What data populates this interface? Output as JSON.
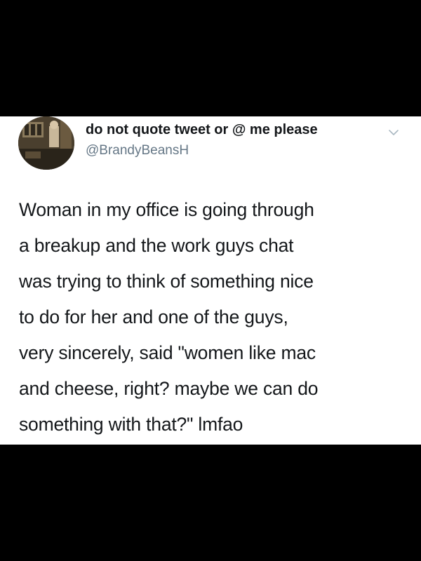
{
  "tweet": {
    "display_name": "do not quote tweet or @ me please",
    "handle": "@BrandyBeansH",
    "avatar_icon": "profile-photo-avatar",
    "menu_icon": "chevron-down-icon",
    "text_lines": [
      "Woman in my office is going through",
      "a breakup and the work guys chat",
      "was trying to think of something nice",
      "to do for her and one of the guys,",
      "very sincerely, said \"women like mac",
      "and cheese, right? maybe we can do",
      "something with that?\" lmfao"
    ]
  },
  "colors": {
    "background": "#000000",
    "card": "#ffffff",
    "text": "#14171a",
    "secondary_text": "#657786"
  }
}
